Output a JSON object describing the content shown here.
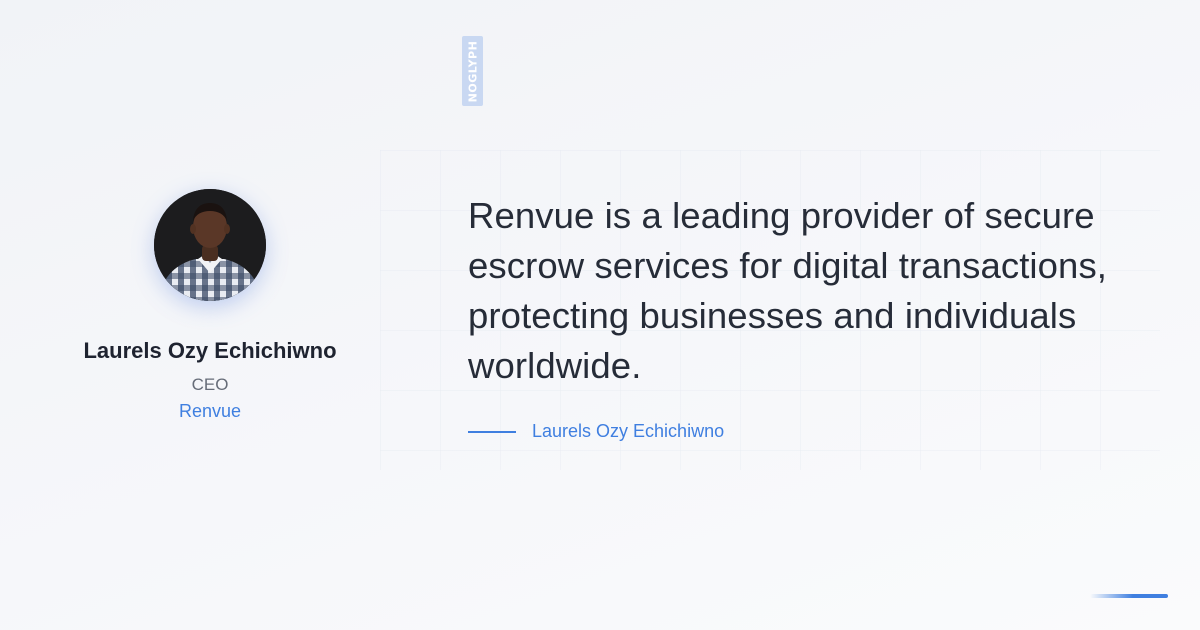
{
  "brand": {
    "logo_text": "NOGLYPH",
    "logo_color": "#c9d8f2"
  },
  "author": {
    "name": "Laurels Ozy Echichiwno",
    "role": "CEO",
    "company": "Renvue"
  },
  "quote": {
    "text": "Renvue is a leading provider of secure escrow services for digital transactions, protecting businesses and individuals worldwide.",
    "attribution": "Laurels Ozy Echichiwno"
  },
  "colors": {
    "accent": "#3f7fe0",
    "text_dark": "#262c38",
    "text_muted": "#666c78",
    "background": "#f3f5f8"
  },
  "icons": {
    "avatar": "person-photo"
  }
}
